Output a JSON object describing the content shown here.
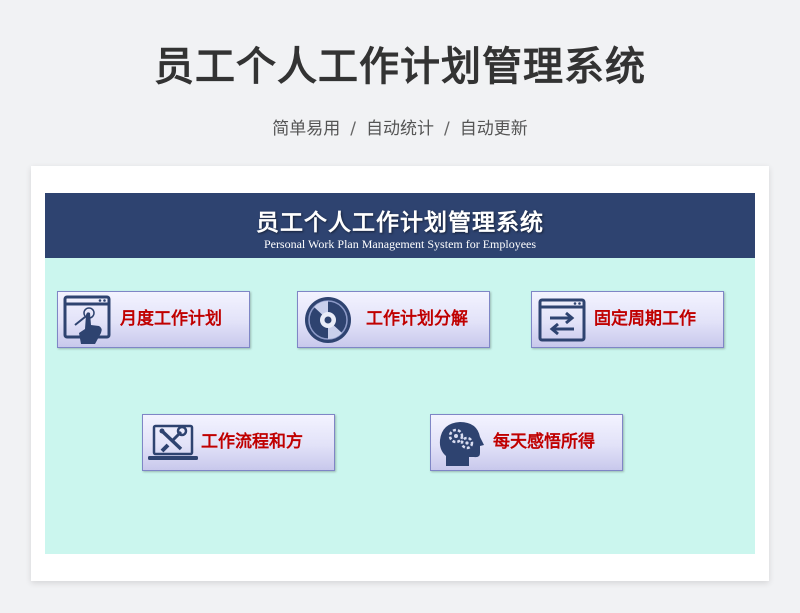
{
  "page": {
    "title": "员工个人工作计划管理系统",
    "subtitle_items": [
      "简单易用",
      "自动统计",
      "自动更新"
    ],
    "separator": "/"
  },
  "app": {
    "title": "员工个人工作计划管理系统",
    "subtitle": "Personal Work Plan Management System for Employees"
  },
  "menu": {
    "monthly_plan": {
      "label": "月度工作计划",
      "icon": "touch-screen-icon"
    },
    "plan_breakdown": {
      "label": "工作计划分解",
      "icon": "disc-icon"
    },
    "fixed_cycle": {
      "label": "固定周期工作",
      "icon": "window-swap-icon"
    },
    "workflow": {
      "label": "工作流程和方",
      "icon": "laptop-tools-icon"
    },
    "daily_insight": {
      "label": "每天感悟所得",
      "icon": "head-gears-icon"
    }
  },
  "colors": {
    "header_band": "#2e4370",
    "content_bg": "#cbf6ee",
    "button_label": "#c00000",
    "icon_fill": "#2e4370"
  }
}
